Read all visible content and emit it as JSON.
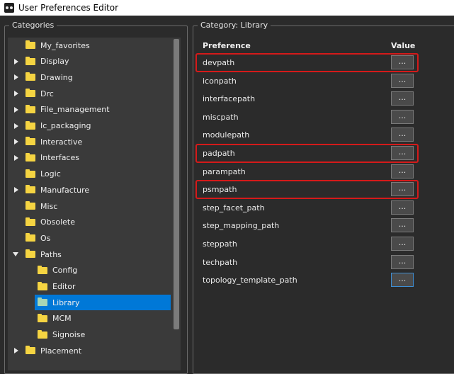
{
  "window": {
    "title": "User Preferences Editor"
  },
  "categories": {
    "title": "Categories",
    "items": [
      {
        "label": "My_favorites",
        "expander": "none",
        "indent": 0
      },
      {
        "label": "Display",
        "expander": "collapsed",
        "indent": 0
      },
      {
        "label": "Drawing",
        "expander": "collapsed",
        "indent": 0
      },
      {
        "label": "Drc",
        "expander": "collapsed",
        "indent": 0
      },
      {
        "label": "File_management",
        "expander": "collapsed",
        "indent": 0
      },
      {
        "label": "Ic_packaging",
        "expander": "collapsed",
        "indent": 0
      },
      {
        "label": "Interactive",
        "expander": "collapsed",
        "indent": 0
      },
      {
        "label": "Interfaces",
        "expander": "collapsed",
        "indent": 0
      },
      {
        "label": "Logic",
        "expander": "none",
        "indent": 0
      },
      {
        "label": "Manufacture",
        "expander": "collapsed",
        "indent": 0
      },
      {
        "label": "Misc",
        "expander": "none",
        "indent": 0
      },
      {
        "label": "Obsolete",
        "expander": "none",
        "indent": 0
      },
      {
        "label": "Os",
        "expander": "none",
        "indent": 0
      },
      {
        "label": "Paths",
        "expander": "expanded",
        "indent": 0
      },
      {
        "label": "Config",
        "expander": "none",
        "indent": 1
      },
      {
        "label": "Editor",
        "expander": "none",
        "indent": 1
      },
      {
        "label": "Library",
        "expander": "none",
        "indent": 1,
        "selected": true
      },
      {
        "label": "MCM",
        "expander": "none",
        "indent": 1
      },
      {
        "label": "Signoise",
        "expander": "none",
        "indent": 1
      },
      {
        "label": "Placement",
        "expander": "collapsed",
        "indent": 0
      }
    ]
  },
  "library": {
    "title": "Category:  Library",
    "col_preference": "Preference",
    "col_value": "Value",
    "button_label": "...",
    "rows": [
      {
        "name": "devpath",
        "highlighted": true
      },
      {
        "name": "iconpath"
      },
      {
        "name": "interfacepath"
      },
      {
        "name": "miscpath"
      },
      {
        "name": "modulepath"
      },
      {
        "name": "padpath",
        "highlighted": true
      },
      {
        "name": "parampath"
      },
      {
        "name": "psmpath",
        "highlighted": true
      },
      {
        "name": "step_facet_path"
      },
      {
        "name": "step_mapping_path"
      },
      {
        "name": "steppath"
      },
      {
        "name": "techpath"
      },
      {
        "name": "topology_template_path",
        "focused": true
      }
    ]
  },
  "colors": {
    "background": "#2b2b2b",
    "selection": "#0078d7",
    "highlight": "#d51a1a",
    "folder": "#f5d442"
  }
}
